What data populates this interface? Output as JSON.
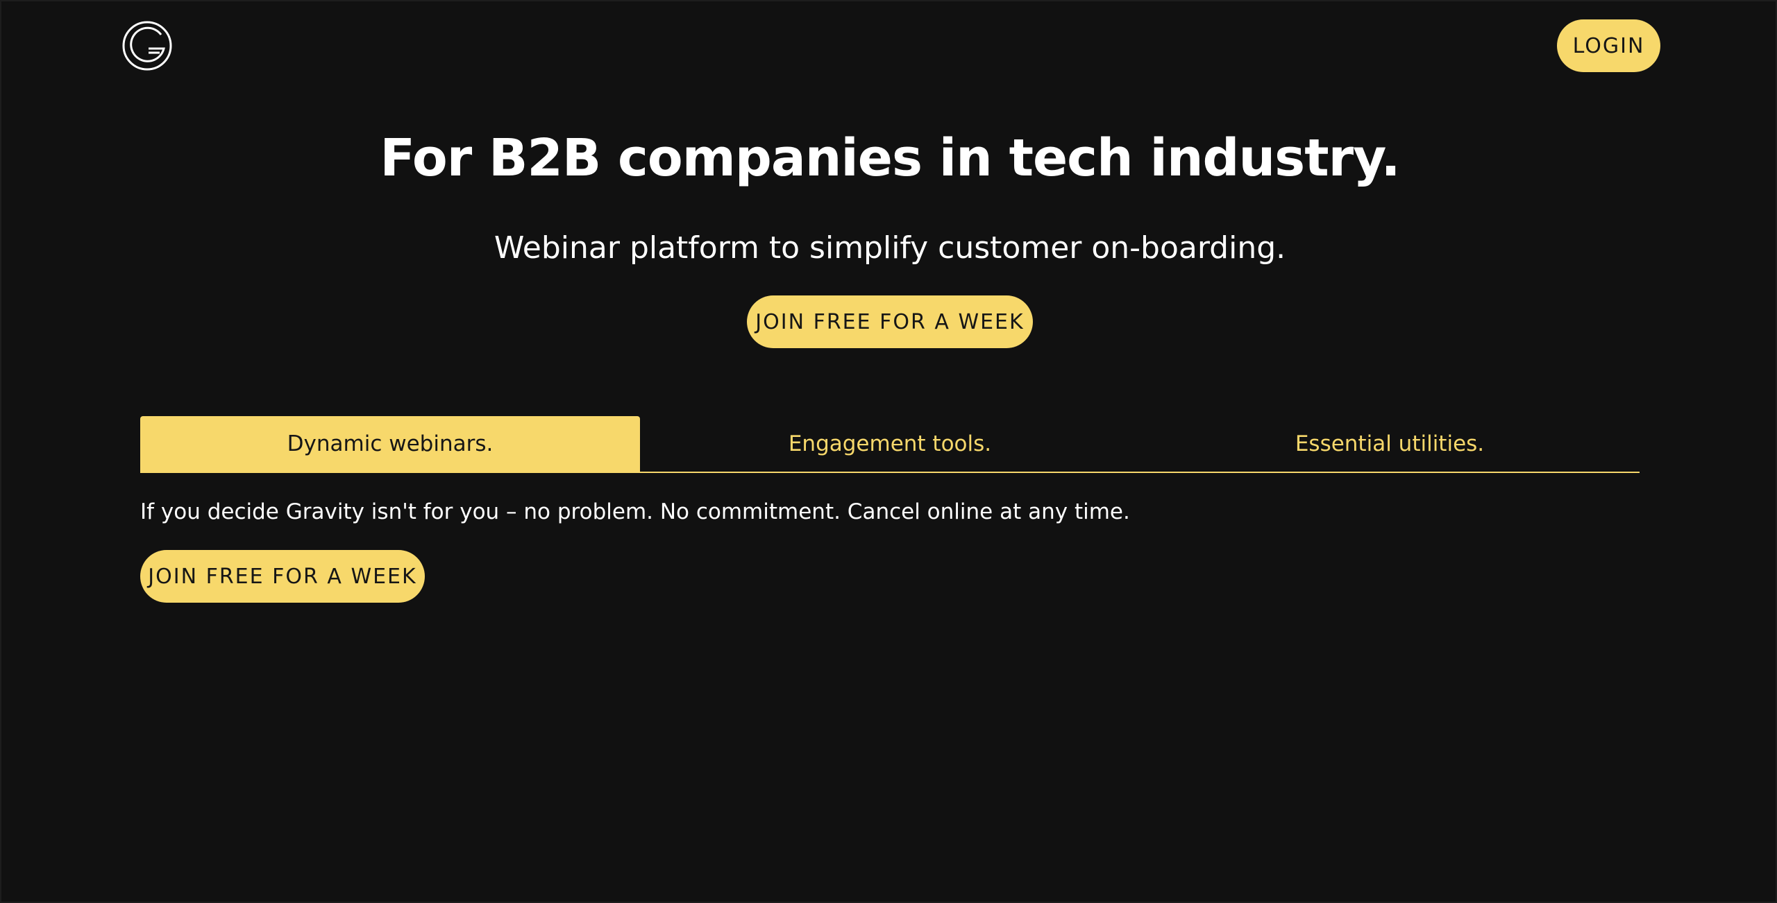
{
  "header": {
    "logo_icon": "gravity-g-logo-icon",
    "login_label": "LOGIN"
  },
  "hero": {
    "title": "For B2B companies in tech industry.",
    "subtitle": "Webinar platform to simplify customer on-boarding.",
    "cta_label": "JOIN FREE FOR A WEEK"
  },
  "tabs": [
    {
      "label": "Dynamic webinars.",
      "active": true
    },
    {
      "label": "Engagement tools.",
      "active": false
    },
    {
      "label": "Essential utilities.",
      "active": false
    }
  ],
  "tab_panel": {
    "note": "If you decide Gravity isn't for you – no problem. No commitment. Cancel online at any time.",
    "cta_label": "JOIN FREE FOR A WEEK"
  },
  "colors": {
    "background": "#111111",
    "accent": "#f7d86b",
    "text": "#ffffff",
    "button_text": "#161616"
  }
}
